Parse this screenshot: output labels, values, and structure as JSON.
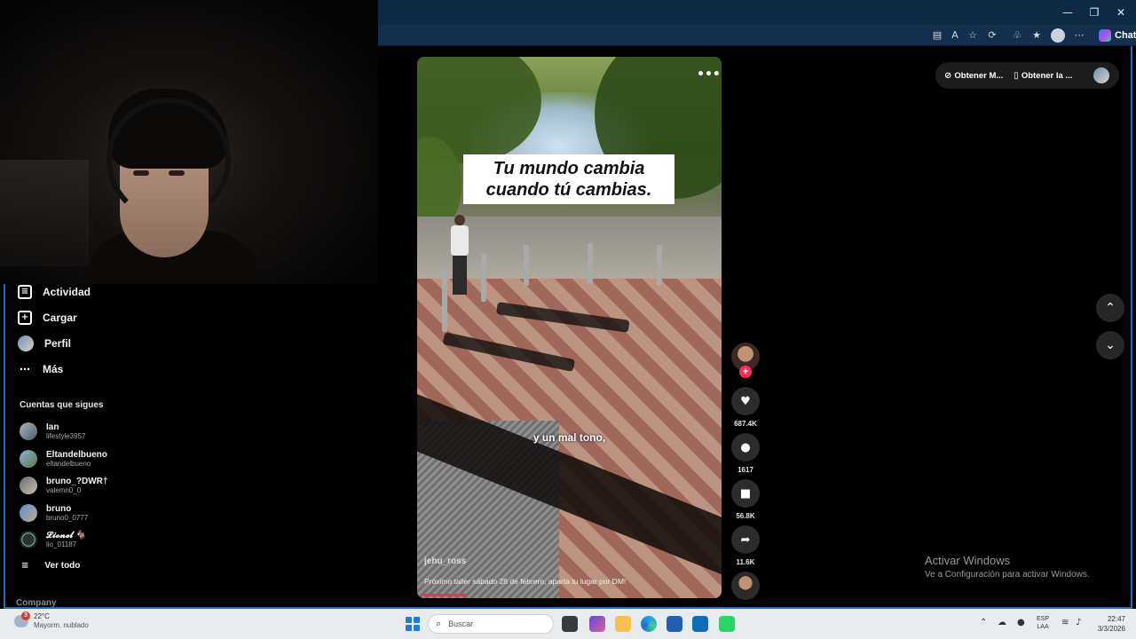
{
  "window": {
    "minimize": "—",
    "restore": "❐",
    "close": "✕"
  },
  "toolbar": {
    "chat_label": "Chat"
  },
  "sidebar": {
    "items": [
      {
        "label": "Actividad",
        "icon": "activity-icon"
      },
      {
        "label": "Cargar",
        "icon": "upload-icon"
      },
      {
        "label": "Perfil",
        "icon": "profile-avatar"
      },
      {
        "label": "Más",
        "icon": "more-icon"
      }
    ],
    "following_title": "Cuentas que sigues",
    "following": [
      {
        "name": "Ian",
        "user": "lifestyle3957"
      },
      {
        "name": "Eltandelbueno",
        "user": "eltandelbueno"
      },
      {
        "name": "bruno_?DWR†",
        "user": "valemn0_0"
      },
      {
        "name": "bruno",
        "user": "bruno0_0777"
      },
      {
        "name": "𝓛𝓲𝓸𝓷𝓮𝓵 🐐",
        "user": "lio_01187"
      }
    ],
    "see_all": "Ver todo",
    "company": "Company"
  },
  "video": {
    "caption": "Tu mundo cambia cuando tú cambias.",
    "subtitle": "y un mal tono,",
    "author": "jehu_ross",
    "description": "Próximo taller sábado 28 de febrero, aparta tu lugar por DM!",
    "more": "•••",
    "progress": 0.15
  },
  "actions": {
    "likes": "687.4K",
    "comments": "1617",
    "saves": "56.8K",
    "shares": "11.6K"
  },
  "top_right": {
    "get_coins": "Obtener M...",
    "get_app": "Obtener la ..."
  },
  "nav": {
    "up": "⌃",
    "down": "⌄"
  },
  "watermark": {
    "title": "Activar Windows",
    "subtitle": "Ve a Configuración para activar Windows."
  },
  "taskbar": {
    "weather_temp": "22°C",
    "weather_desc": "Mayorm. nublado",
    "weather_badge": "3",
    "search_placeholder": "Buscar",
    "lang_1": "ESP",
    "lang_2": "LAA",
    "time": "22:47",
    "date": "3/3/2026"
  }
}
